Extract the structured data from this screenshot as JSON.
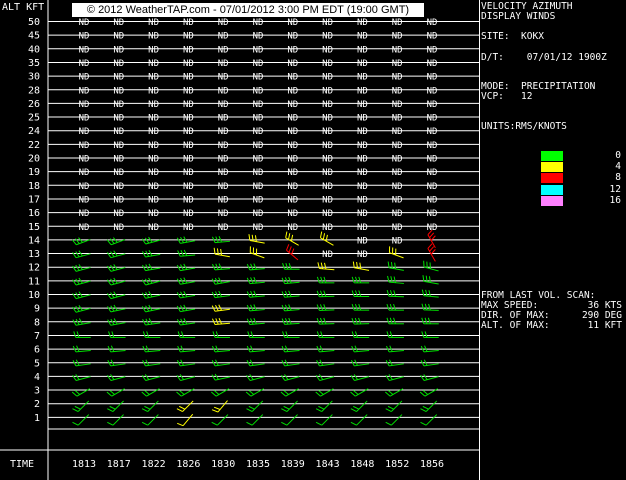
{
  "header": {
    "alt_label": "ALT KFT",
    "copyright": "© 2012 WeatherTAP.com - 07/01/2012  3:00 PM EDT (19:00 GMT)"
  },
  "altitudes": [
    "50",
    "45",
    "40",
    "35",
    "30",
    "28",
    "26",
    "25",
    "24",
    "22",
    "20",
    "19",
    "18",
    "17",
    "16",
    "15",
    "14",
    "13",
    "12",
    "11",
    "10",
    "9",
    "8",
    "7",
    "6",
    "5",
    "4",
    "3",
    "2",
    "1"
  ],
  "times": [
    "1813",
    "1817",
    "1822",
    "1826",
    "1830",
    "1835",
    "1839",
    "1843",
    "1848",
    "1852",
    "1856"
  ],
  "time_label": "TIME",
  "no_data_text": "ND",
  "wind_grid": [
    [
      "ND",
      "ND",
      "ND",
      "ND",
      "ND",
      "ND",
      "ND",
      "ND",
      "ND",
      "ND",
      "ND"
    ],
    [
      "ND",
      "ND",
      "ND",
      "ND",
      "ND",
      "ND",
      "ND",
      "ND",
      "ND",
      "ND",
      "ND"
    ],
    [
      "ND",
      "ND",
      "ND",
      "ND",
      "ND",
      "ND",
      "ND",
      "ND",
      "ND",
      "ND",
      "ND"
    ],
    [
      "ND",
      "ND",
      "ND",
      "ND",
      "ND",
      "ND",
      "ND",
      "ND",
      "ND",
      "ND",
      "ND"
    ],
    [
      "ND",
      "ND",
      "ND",
      "ND",
      "ND",
      "ND",
      "ND",
      "ND",
      "ND",
      "ND",
      "ND"
    ],
    [
      "ND",
      "ND",
      "ND",
      "ND",
      "ND",
      "ND",
      "ND",
      "ND",
      "ND",
      "ND",
      "ND"
    ],
    [
      "ND",
      "ND",
      "ND",
      "ND",
      "ND",
      "ND",
      "ND",
      "ND",
      "ND",
      "ND",
      "ND"
    ],
    [
      "ND",
      "ND",
      "ND",
      "ND",
      "ND",
      "ND",
      "ND",
      "ND",
      "ND",
      "ND",
      "ND"
    ],
    [
      "ND",
      "ND",
      "ND",
      "ND",
      "ND",
      "ND",
      "ND",
      "ND",
      "ND",
      "ND",
      "ND"
    ],
    [
      "ND",
      "ND",
      "ND",
      "ND",
      "ND",
      "ND",
      "ND",
      "ND",
      "ND",
      "ND",
      "ND"
    ],
    [
      "ND",
      "ND",
      "ND",
      "ND",
      "ND",
      "ND",
      "ND",
      "ND",
      "ND",
      "ND",
      "ND"
    ],
    [
      "ND",
      "ND",
      "ND",
      "ND",
      "ND",
      "ND",
      "ND",
      "ND",
      "ND",
      "ND",
      "ND"
    ],
    [
      "ND",
      "ND",
      "ND",
      "ND",
      "ND",
      "ND",
      "ND",
      "ND",
      "ND",
      "ND",
      "ND"
    ],
    [
      "ND",
      "ND",
      "ND",
      "ND",
      "ND",
      "ND",
      "ND",
      "ND",
      "ND",
      "ND",
      "ND"
    ],
    [
      "ND",
      "ND",
      "ND",
      "ND",
      "ND",
      "ND",
      "ND",
      "ND",
      "ND",
      "ND",
      "ND"
    ],
    [
      "ND",
      "ND",
      "ND",
      "ND",
      "ND",
      "ND",
      "ND",
      "ND",
      "ND",
      "ND",
      "ND"
    ],
    [
      {
        "c": "g",
        "d": 250,
        "b": 3
      },
      {
        "c": "g",
        "d": 250,
        "b": 3
      },
      {
        "c": "g",
        "d": 255,
        "b": 3
      },
      {
        "c": "g",
        "d": 260,
        "b": 3
      },
      {
        "c": "g",
        "d": 265,
        "b": 3
      },
      {
        "c": "y",
        "d": 280,
        "b": 3
      },
      {
        "c": "y",
        "d": 300,
        "b": 3
      },
      {
        "c": "y",
        "d": 300,
        "b": 3
      },
      "ND",
      "ND",
      {
        "c": "r",
        "d": 330,
        "b": 3
      }
    ],
    [
      {
        "c": "g",
        "d": 255,
        "b": 3
      },
      {
        "c": "g",
        "d": 255,
        "b": 3
      },
      {
        "c": "g",
        "d": 260,
        "b": 3
      },
      {
        "c": "g",
        "d": 265,
        "b": 3
      },
      {
        "c": "y",
        "d": 280,
        "b": 3
      },
      {
        "c": "y",
        "d": 290,
        "b": 3
      },
      {
        "c": "r",
        "d": 310,
        "b": 3
      },
      "ND",
      "ND",
      {
        "c": "y",
        "d": 290,
        "b": 3
      },
      {
        "c": "r",
        "d": 330,
        "b": 3
      }
    ],
    [
      {
        "c": "g",
        "d": 255,
        "b": 3
      },
      {
        "c": "g",
        "d": 255,
        "b": 3
      },
      {
        "c": "g",
        "d": 260,
        "b": 3
      },
      {
        "c": "g",
        "d": 260,
        "b": 3
      },
      {
        "c": "g",
        "d": 265,
        "b": 3
      },
      {
        "c": "g",
        "d": 265,
        "b": 3
      },
      {
        "c": "g",
        "d": 270,
        "b": 3
      },
      {
        "c": "y",
        "d": 275,
        "b": 3
      },
      {
        "c": "y",
        "d": 280,
        "b": 3
      },
      {
        "c": "g",
        "d": 280,
        "b": 3
      },
      {
        "c": "g",
        "d": 285,
        "b": 3
      }
    ],
    [
      {
        "c": "g",
        "d": 255,
        "b": 3
      },
      {
        "c": "g",
        "d": 255,
        "b": 3
      },
      {
        "c": "g",
        "d": 255,
        "b": 3
      },
      {
        "c": "g",
        "d": 260,
        "b": 3
      },
      {
        "c": "g",
        "d": 260,
        "b": 3
      },
      {
        "c": "g",
        "d": 265,
        "b": 3
      },
      {
        "c": "g",
        "d": 265,
        "b": 3
      },
      {
        "c": "g",
        "d": 270,
        "b": 3
      },
      {
        "c": "g",
        "d": 270,
        "b": 3
      },
      {
        "c": "g",
        "d": 275,
        "b": 3
      },
      {
        "c": "g",
        "d": 280,
        "b": 3
      }
    ],
    [
      {
        "c": "g",
        "d": 255,
        "b": 3
      },
      {
        "c": "g",
        "d": 255,
        "b": 3
      },
      {
        "c": "g",
        "d": 258,
        "b": 3
      },
      {
        "c": "g",
        "d": 260,
        "b": 3
      },
      {
        "c": "g",
        "d": 262,
        "b": 3
      },
      {
        "c": "g",
        "d": 265,
        "b": 3
      },
      {
        "c": "g",
        "d": 265,
        "b": 3
      },
      {
        "c": "g",
        "d": 268,
        "b": 3
      },
      {
        "c": "g",
        "d": 270,
        "b": 3
      },
      {
        "c": "g",
        "d": 272,
        "b": 3
      },
      {
        "c": "g",
        "d": 275,
        "b": 3
      }
    ],
    [
      {
        "c": "g",
        "d": 255,
        "b": 3
      },
      {
        "c": "g",
        "d": 258,
        "b": 3
      },
      {
        "c": "g",
        "d": 258,
        "b": 3
      },
      {
        "c": "g",
        "d": 260,
        "b": 3
      },
      {
        "c": "y",
        "d": 262,
        "b": 3
      },
      {
        "c": "g",
        "d": 265,
        "b": 3
      },
      {
        "c": "g",
        "d": 265,
        "b": 3
      },
      {
        "c": "g",
        "d": 268,
        "b": 3
      },
      {
        "c": "g",
        "d": 270,
        "b": 3
      },
      {
        "c": "g",
        "d": 270,
        "b": 3
      },
      {
        "c": "g",
        "d": 272,
        "b": 3
      }
    ],
    [
      {
        "c": "g",
        "d": 260,
        "b": 3
      },
      {
        "c": "g",
        "d": 260,
        "b": 3
      },
      {
        "c": "g",
        "d": 262,
        "b": 3
      },
      {
        "c": "g",
        "d": 262,
        "b": 3
      },
      {
        "c": "y",
        "d": 265,
        "b": 3
      },
      {
        "c": "g",
        "d": 265,
        "b": 3
      },
      {
        "c": "g",
        "d": 266,
        "b": 3
      },
      {
        "c": "g",
        "d": 268,
        "b": 3
      },
      {
        "c": "g",
        "d": 268,
        "b": 3
      },
      {
        "c": "g",
        "d": 270,
        "b": 3
      },
      {
        "c": "g",
        "d": 270,
        "b": 3
      }
    ],
    [
      {
        "c": "g",
        "d": 270,
        "b": 2
      },
      {
        "c": "g",
        "d": 270,
        "b": 2
      },
      {
        "c": "g",
        "d": 270,
        "b": 2
      },
      {
        "c": "g",
        "d": 270,
        "b": 2
      },
      {
        "c": "g",
        "d": 270,
        "b": 2
      },
      {
        "c": "g",
        "d": 270,
        "b": 2
      },
      {
        "c": "g",
        "d": 270,
        "b": 2
      },
      {
        "c": "g",
        "d": 270,
        "b": 2
      },
      {
        "c": "g",
        "d": 270,
        "b": 2
      },
      {
        "c": "g",
        "d": 270,
        "b": 2
      },
      {
        "c": "g",
        "d": 270,
        "b": 2
      }
    ],
    [
      {
        "c": "g",
        "d": 265,
        "b": 2
      },
      {
        "c": "g",
        "d": 265,
        "b": 2
      },
      {
        "c": "g",
        "d": 265,
        "b": 2
      },
      {
        "c": "g",
        "d": 265,
        "b": 2
      },
      {
        "c": "g",
        "d": 265,
        "b": 2
      },
      {
        "c": "g",
        "d": 265,
        "b": 2
      },
      {
        "c": "g",
        "d": 265,
        "b": 2
      },
      {
        "c": "g",
        "d": 265,
        "b": 2
      },
      {
        "c": "g",
        "d": 265,
        "b": 2
      },
      {
        "c": "g",
        "d": 265,
        "b": 2
      },
      {
        "c": "g",
        "d": 265,
        "b": 2
      }
    ],
    [
      {
        "c": "g",
        "d": 262,
        "b": 2
      },
      {
        "c": "g",
        "d": 262,
        "b": 2
      },
      {
        "c": "g",
        "d": 262,
        "b": 2
      },
      {
        "c": "g",
        "d": 262,
        "b": 2
      },
      {
        "c": "g",
        "d": 262,
        "b": 2
      },
      {
        "c": "g",
        "d": 262,
        "b": 2
      },
      {
        "c": "g",
        "d": 262,
        "b": 2
      },
      {
        "c": "g",
        "d": 262,
        "b": 2
      },
      {
        "c": "g",
        "d": 262,
        "b": 2
      },
      {
        "c": "g",
        "d": 262,
        "b": 2
      },
      {
        "c": "g",
        "d": 262,
        "b": 2
      }
    ],
    [
      {
        "c": "g",
        "d": 255,
        "b": 2
      },
      {
        "c": "g",
        "d": 255,
        "b": 2
      },
      {
        "c": "g",
        "d": 255,
        "b": 2
      },
      {
        "c": "g",
        "d": 255,
        "b": 2
      },
      {
        "c": "g",
        "d": 258,
        "b": 2
      },
      {
        "c": "g",
        "d": 255,
        "b": 2
      },
      {
        "c": "g",
        "d": 255,
        "b": 2
      },
      {
        "c": "g",
        "d": 255,
        "b": 2
      },
      {
        "c": "g",
        "d": 255,
        "b": 2
      },
      {
        "c": "g",
        "d": 255,
        "b": 2
      },
      {
        "c": "g",
        "d": 255,
        "b": 2
      }
    ],
    [
      {
        "c": "g",
        "d": 240,
        "b": 2
      },
      {
        "c": "g",
        "d": 240,
        "b": 2
      },
      {
        "c": "g",
        "d": 240,
        "b": 2
      },
      {
        "c": "g",
        "d": 240,
        "b": 2
      },
      {
        "c": "g",
        "d": 240,
        "b": 2
      },
      {
        "c": "g",
        "d": 240,
        "b": 2
      },
      {
        "c": "g",
        "d": 240,
        "b": 2
      },
      {
        "c": "g",
        "d": 240,
        "b": 2
      },
      {
        "c": "g",
        "d": 240,
        "b": 2
      },
      {
        "c": "g",
        "d": 240,
        "b": 2
      },
      {
        "c": "g",
        "d": 240,
        "b": 2
      }
    ],
    [
      {
        "c": "g",
        "d": 225,
        "b": 2
      },
      {
        "c": "g",
        "d": 225,
        "b": 2
      },
      {
        "c": "g",
        "d": 225,
        "b": 2
      },
      {
        "c": "y",
        "d": 225,
        "b": 2
      },
      {
        "c": "y",
        "d": 220,
        "b": 2
      },
      {
        "c": "g",
        "d": 225,
        "b": 2
      },
      {
        "c": "g",
        "d": 225,
        "b": 2
      },
      {
        "c": "g",
        "d": 225,
        "b": 2
      },
      {
        "c": "g",
        "d": 225,
        "b": 2
      },
      {
        "c": "g",
        "d": 225,
        "b": 2
      },
      {
        "c": "g",
        "d": 225,
        "b": 2
      }
    ],
    [
      {
        "c": "g",
        "d": 225,
        "b": 1
      },
      {
        "c": "g",
        "d": 225,
        "b": 1
      },
      {
        "c": "g",
        "d": 225,
        "b": 1
      },
      {
        "c": "y",
        "d": 220,
        "b": 1
      },
      {
        "c": "g",
        "d": 225,
        "b": 1
      },
      {
        "c": "g",
        "d": 225,
        "b": 1
      },
      {
        "c": "g",
        "d": 225,
        "b": 1
      },
      {
        "c": "g",
        "d": 225,
        "b": 1
      },
      {
        "c": "g",
        "d": 225,
        "b": 1
      },
      {
        "c": "g",
        "d": 225,
        "b": 1
      },
      {
        "c": "g",
        "d": 225,
        "b": 1
      }
    ]
  ],
  "side_panel": {
    "title": "VELOCITY AZIMUTH\nDISPLAY WINDS",
    "site": "SITE:  KOKX",
    "dt": "D/T:    07/01/12 1900Z",
    "mode": "MODE:  PRECIPITATION\nVCP:   12",
    "units": "UNITS:RMS/KNOTS",
    "legend": [
      {
        "value": "0",
        "color": "#00ff00"
      },
      {
        "value": "4",
        "color": "#ffff00"
      },
      {
        "value": "8",
        "color": "#ff0000"
      },
      {
        "value": "12",
        "color": "#00ffff"
      },
      {
        "value": "16",
        "color": "#ff80ff"
      }
    ],
    "scan_heading": "FROM LAST VOL. SCAN:",
    "stats": [
      {
        "label": "MAX SPEED:",
        "value": "36 KTS"
      },
      {
        "label": "DIR. OF MAX:",
        "value": "290 DEG"
      },
      {
        "label": "ALT. OF MAX:",
        "value": "11 KFT"
      }
    ]
  },
  "colors": {
    "g": "#00e000",
    "y": "#ffff00",
    "r": "#ff0000",
    "grid": "#ffffff",
    "bg": "#000000"
  }
}
